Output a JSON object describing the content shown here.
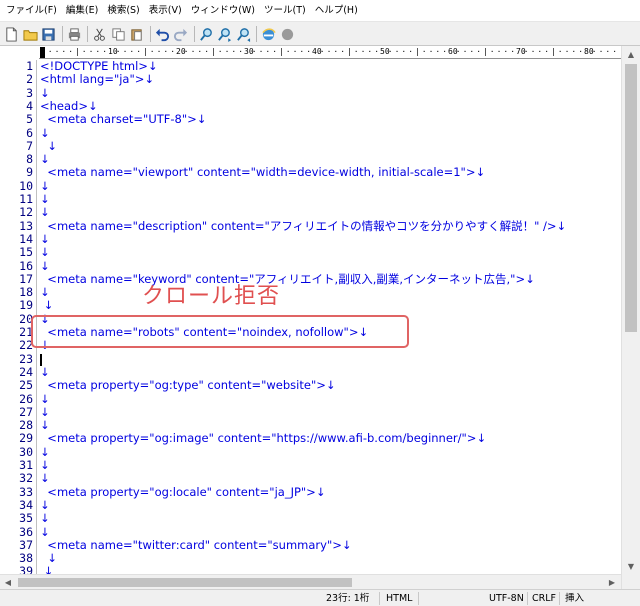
{
  "menu": [
    "ファイル(F)",
    "編集(E)",
    "検索(S)",
    "表示(V)",
    "ウィンドウ(W)",
    "ツール(T)",
    "ヘルプ(H)"
  ],
  "toolbar_icons": [
    "new-file-icon",
    "open-folder-icon",
    "save-icon",
    "print-icon",
    "cut-icon",
    "copy-icon",
    "paste-icon",
    "undo-icon",
    "redo-icon",
    "find-icon",
    "find-next-icon",
    "find-prev-icon",
    "browser-icon",
    "record-icon"
  ],
  "ruler": {
    "marks": [
      "0",
      "10",
      "20",
      "30",
      "40",
      "50",
      "60",
      "70",
      "80"
    ]
  },
  "editor": {
    "lines": [
      {
        "n": "1",
        "t": "<!DOCTYPE html>↓"
      },
      {
        "n": "2",
        "t": "<html lang=\"ja\">↓"
      },
      {
        "n": "3",
        "t": "↓"
      },
      {
        "n": "4",
        "t": "<head>↓"
      },
      {
        "n": "5",
        "t": "  <meta charset=\"UTF-8\">↓"
      },
      {
        "n": "6",
        "t": "↓"
      },
      {
        "n": "7",
        "t": "  ↓"
      },
      {
        "n": "8",
        "t": "↓"
      },
      {
        "n": "9",
        "t": "  <meta name=\"viewport\" content=\"width=device-width, initial-scale=1\">↓"
      },
      {
        "n": "10",
        "t": "↓"
      },
      {
        "n": "11",
        "t": "↓"
      },
      {
        "n": "12",
        "t": "↓"
      },
      {
        "n": "13",
        "t": "  <meta name=\"description\" content=\"アフィリエイトの情報やコツを分かりやすく解説！\" />↓"
      },
      {
        "n": "14",
        "t": "↓"
      },
      {
        "n": "15",
        "t": "↓"
      },
      {
        "n": "16",
        "t": "↓"
      },
      {
        "n": "17",
        "t": "  <meta name=\"keyword\" content=\"アフィリエイト,副収入,副業,インターネット広告,\">↓"
      },
      {
        "n": "18",
        "t": "↓"
      },
      {
        "n": "19",
        "t": " ↓"
      },
      {
        "n": "20",
        "t": "↓"
      },
      {
        "n": "21",
        "t": "  <meta name=\"robots\" content=\"noindex, nofollow\">↓"
      },
      {
        "n": "22",
        "t": "↓"
      },
      {
        "n": "23",
        "t": ""
      },
      {
        "n": "24",
        "t": "↓"
      },
      {
        "n": "25",
        "t": "  <meta property=\"og:type\" content=\"website\">↓"
      },
      {
        "n": "26",
        "t": "↓"
      },
      {
        "n": "27",
        "t": "↓"
      },
      {
        "n": "28",
        "t": "↓"
      },
      {
        "n": "29",
        "t": "  <meta property=\"og:image\" content=\"https://www.afi-b.com/beginner/\">↓"
      },
      {
        "n": "30",
        "t": "↓"
      },
      {
        "n": "31",
        "t": "↓"
      },
      {
        "n": "32",
        "t": "↓"
      },
      {
        "n": "33",
        "t": "  <meta property=\"og:locale\" content=\"ja_JP\">↓"
      },
      {
        "n": "34",
        "t": "↓"
      },
      {
        "n": "35",
        "t": "↓"
      },
      {
        "n": "36",
        "t": "↓"
      },
      {
        "n": "37",
        "t": "  <meta name=\"twitter:card\" content=\"summary\">↓"
      },
      {
        "n": "38",
        "t": "  ↓"
      },
      {
        "n": "39",
        "t": " ↓"
      }
    ]
  },
  "annotation": {
    "label": "クロール拒否",
    "color": "#e05050"
  },
  "status": {
    "position": "23行:  1桁",
    "mode": "HTML",
    "encoding": "UTF-8N",
    "newline": "CRLF",
    "insert": "挿入"
  },
  "colors": {
    "code_text": "#0000e0",
    "line_numbers": "#000080",
    "annotation": "#e06464"
  }
}
